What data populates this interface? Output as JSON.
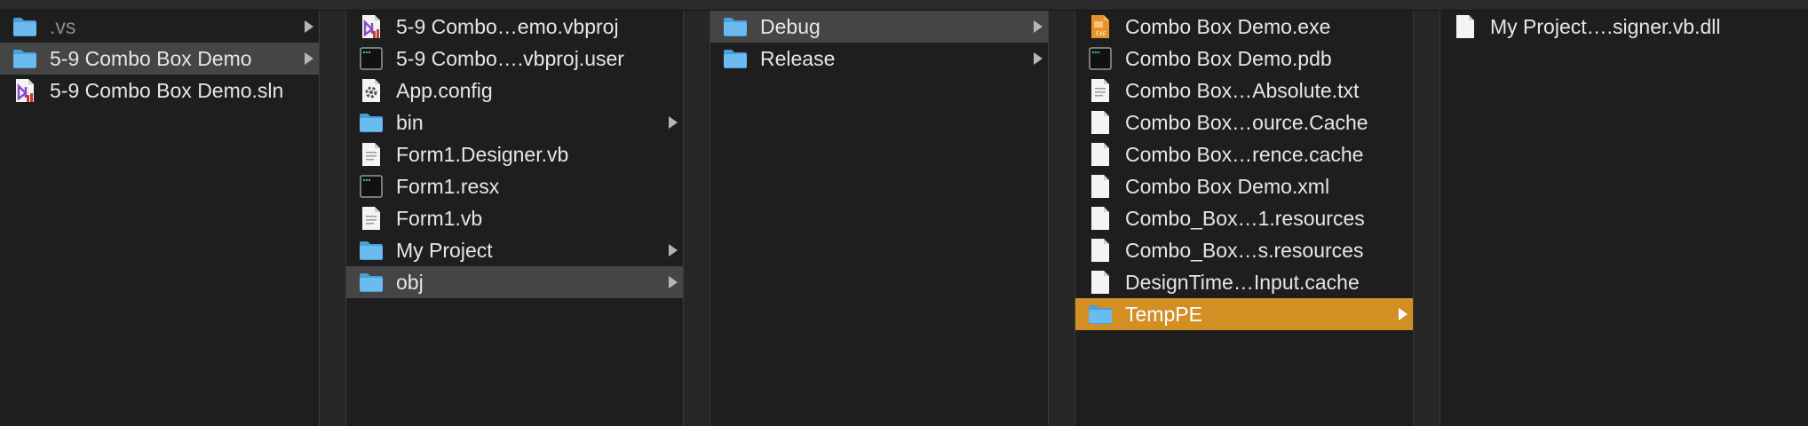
{
  "columns": [
    {
      "items": [
        {
          "label": ".vs",
          "icon": "folder-icon",
          "hasChildren": true,
          "dim": true
        },
        {
          "label": "5-9 Combo Box Demo",
          "icon": "folder-icon",
          "hasChildren": true,
          "selected": "inactive"
        },
        {
          "label": "5-9 Combo Box Demo.sln",
          "icon": "vs-solution-icon"
        }
      ]
    },
    {
      "items": [
        {
          "label": "5-9 Combo…emo.vbproj",
          "icon": "vs-project-icon"
        },
        {
          "label": "5-9 Combo….vbproj.user",
          "icon": "terminal-file-icon"
        },
        {
          "label": "App.config",
          "icon": "config-file-icon"
        },
        {
          "label": "bin",
          "icon": "folder-icon",
          "hasChildren": true
        },
        {
          "label": "Form1.Designer.vb",
          "icon": "text-document-icon"
        },
        {
          "label": "Form1.resx",
          "icon": "terminal-file-icon"
        },
        {
          "label": "Form1.vb",
          "icon": "text-document-icon"
        },
        {
          "label": "My Project",
          "icon": "folder-icon",
          "hasChildren": true
        },
        {
          "label": "obj",
          "icon": "folder-icon",
          "hasChildren": true,
          "selected": "inactive"
        }
      ]
    },
    {
      "items": [
        {
          "label": "Debug",
          "icon": "folder-icon",
          "hasChildren": true,
          "selected": "inactive"
        },
        {
          "label": "Release",
          "icon": "folder-icon",
          "hasChildren": true
        }
      ]
    },
    {
      "items": [
        {
          "label": "Combo Box Demo.exe",
          "icon": "exe-file-icon"
        },
        {
          "label": "Combo Box Demo.pdb",
          "icon": "terminal-file-icon"
        },
        {
          "label": "Combo Box…Absolute.txt",
          "icon": "text-document-icon"
        },
        {
          "label": "Combo Box…ource.Cache",
          "icon": "blank-file-icon"
        },
        {
          "label": "Combo Box…rence.cache",
          "icon": "blank-file-icon"
        },
        {
          "label": "Combo Box Demo.xml",
          "icon": "blank-file-icon"
        },
        {
          "label": "Combo_Box…1.resources",
          "icon": "blank-file-icon"
        },
        {
          "label": "Combo_Box…s.resources",
          "icon": "blank-file-icon"
        },
        {
          "label": "DesignTime…Input.cache",
          "icon": "blank-file-icon"
        },
        {
          "label": "TempPE",
          "icon": "folder-icon",
          "hasChildren": true,
          "selected": "active"
        }
      ]
    },
    {
      "items": [
        {
          "label": "My Project….signer.vb.dll",
          "icon": "blank-file-icon"
        }
      ]
    }
  ],
  "colors": {
    "accent": "#d28f24",
    "selection_inactive": "#454545",
    "folder": "#5fb0e6"
  }
}
